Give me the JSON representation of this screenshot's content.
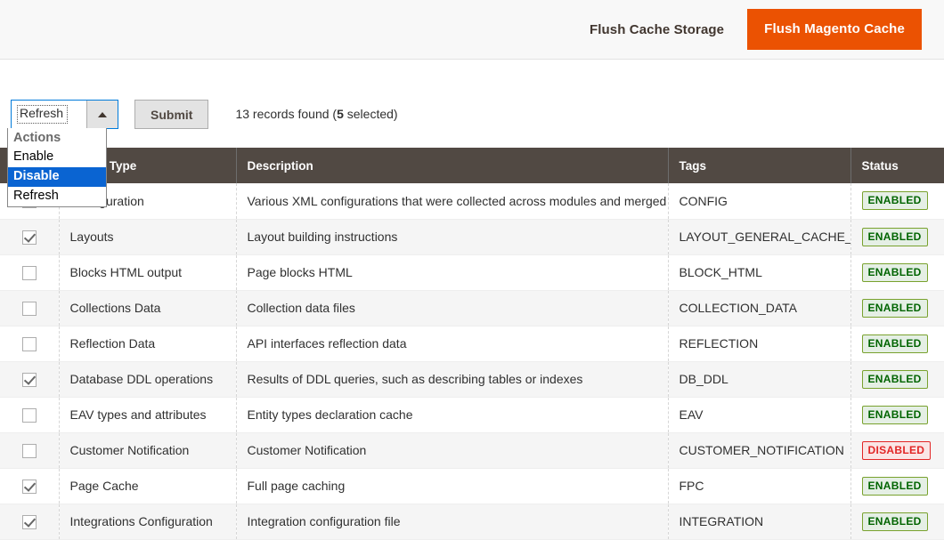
{
  "header": {
    "flush_cache_storage_label": "Flush Cache Storage",
    "flush_magento_cache_label": "Flush Magento Cache",
    "primary_color": "#eb5202"
  },
  "toolbar": {
    "selected_action": "Refresh",
    "caret_icon": "chevron-up-icon",
    "submit_label": "Submit",
    "records_found_count": "13",
    "records_found_prefix": "13 records found (",
    "selected_count": "5",
    "records_found_suffix": " selected)",
    "actions_dropdown": {
      "open": true,
      "group_label": "Actions",
      "options": [
        {
          "label": "Enable",
          "selected": false
        },
        {
          "label": "Disable",
          "selected": true
        },
        {
          "label": "Refresh",
          "selected": false
        }
      ],
      "highlight_color": "#0a64d2"
    }
  },
  "grid": {
    "columns": [
      {
        "key": "checkbox",
        "label": ""
      },
      {
        "key": "type",
        "label": "Cache Type"
      },
      {
        "key": "description",
        "label": "Description"
      },
      {
        "key": "tags",
        "label": "Tags"
      },
      {
        "key": "status",
        "label": "Status"
      }
    ],
    "rows": [
      {
        "checked": false,
        "type": "Configuration",
        "description": "Various XML configurations that were collected across modules and merged",
        "tags": "CONFIG",
        "status": "ENABLED"
      },
      {
        "checked": true,
        "type": "Layouts",
        "description": "Layout building instructions",
        "tags": "LAYOUT_GENERAL_CACHE_TAG",
        "status": "ENABLED"
      },
      {
        "checked": false,
        "type": "Blocks HTML output",
        "description": "Page blocks HTML",
        "tags": "BLOCK_HTML",
        "status": "ENABLED"
      },
      {
        "checked": false,
        "type": "Collections Data",
        "description": "Collection data files",
        "tags": "COLLECTION_DATA",
        "status": "ENABLED"
      },
      {
        "checked": false,
        "type": "Reflection Data",
        "description": "API interfaces reflection data",
        "tags": "REFLECTION",
        "status": "ENABLED"
      },
      {
        "checked": true,
        "type": "Database DDL operations",
        "description": "Results of DDL queries, such as describing tables or indexes",
        "tags": "DB_DDL",
        "status": "ENABLED"
      },
      {
        "checked": false,
        "type": "EAV types and attributes",
        "description": "Entity types declaration cache",
        "tags": "EAV",
        "status": "ENABLED"
      },
      {
        "checked": false,
        "type": "Customer Notification",
        "description": "Customer Notification",
        "tags": "CUSTOMER_NOTIFICATION",
        "status": "DISABLED"
      },
      {
        "checked": true,
        "type": "Page Cache",
        "description": "Full page caching",
        "tags": "FPC",
        "status": "ENABLED"
      },
      {
        "checked": true,
        "type": "Integrations Configuration",
        "description": "Integration configuration file",
        "tags": "INTEGRATION",
        "status": "ENABLED"
      }
    ],
    "status_colors": {
      "enabled_text": "#006400",
      "enabled_bg": "#e5efe5",
      "enabled_border": "#79a22e",
      "disabled_text": "#e22626",
      "disabled_bg": "#fae5e5",
      "disabled_border": "#e22626"
    },
    "header_bg": "#514943"
  }
}
